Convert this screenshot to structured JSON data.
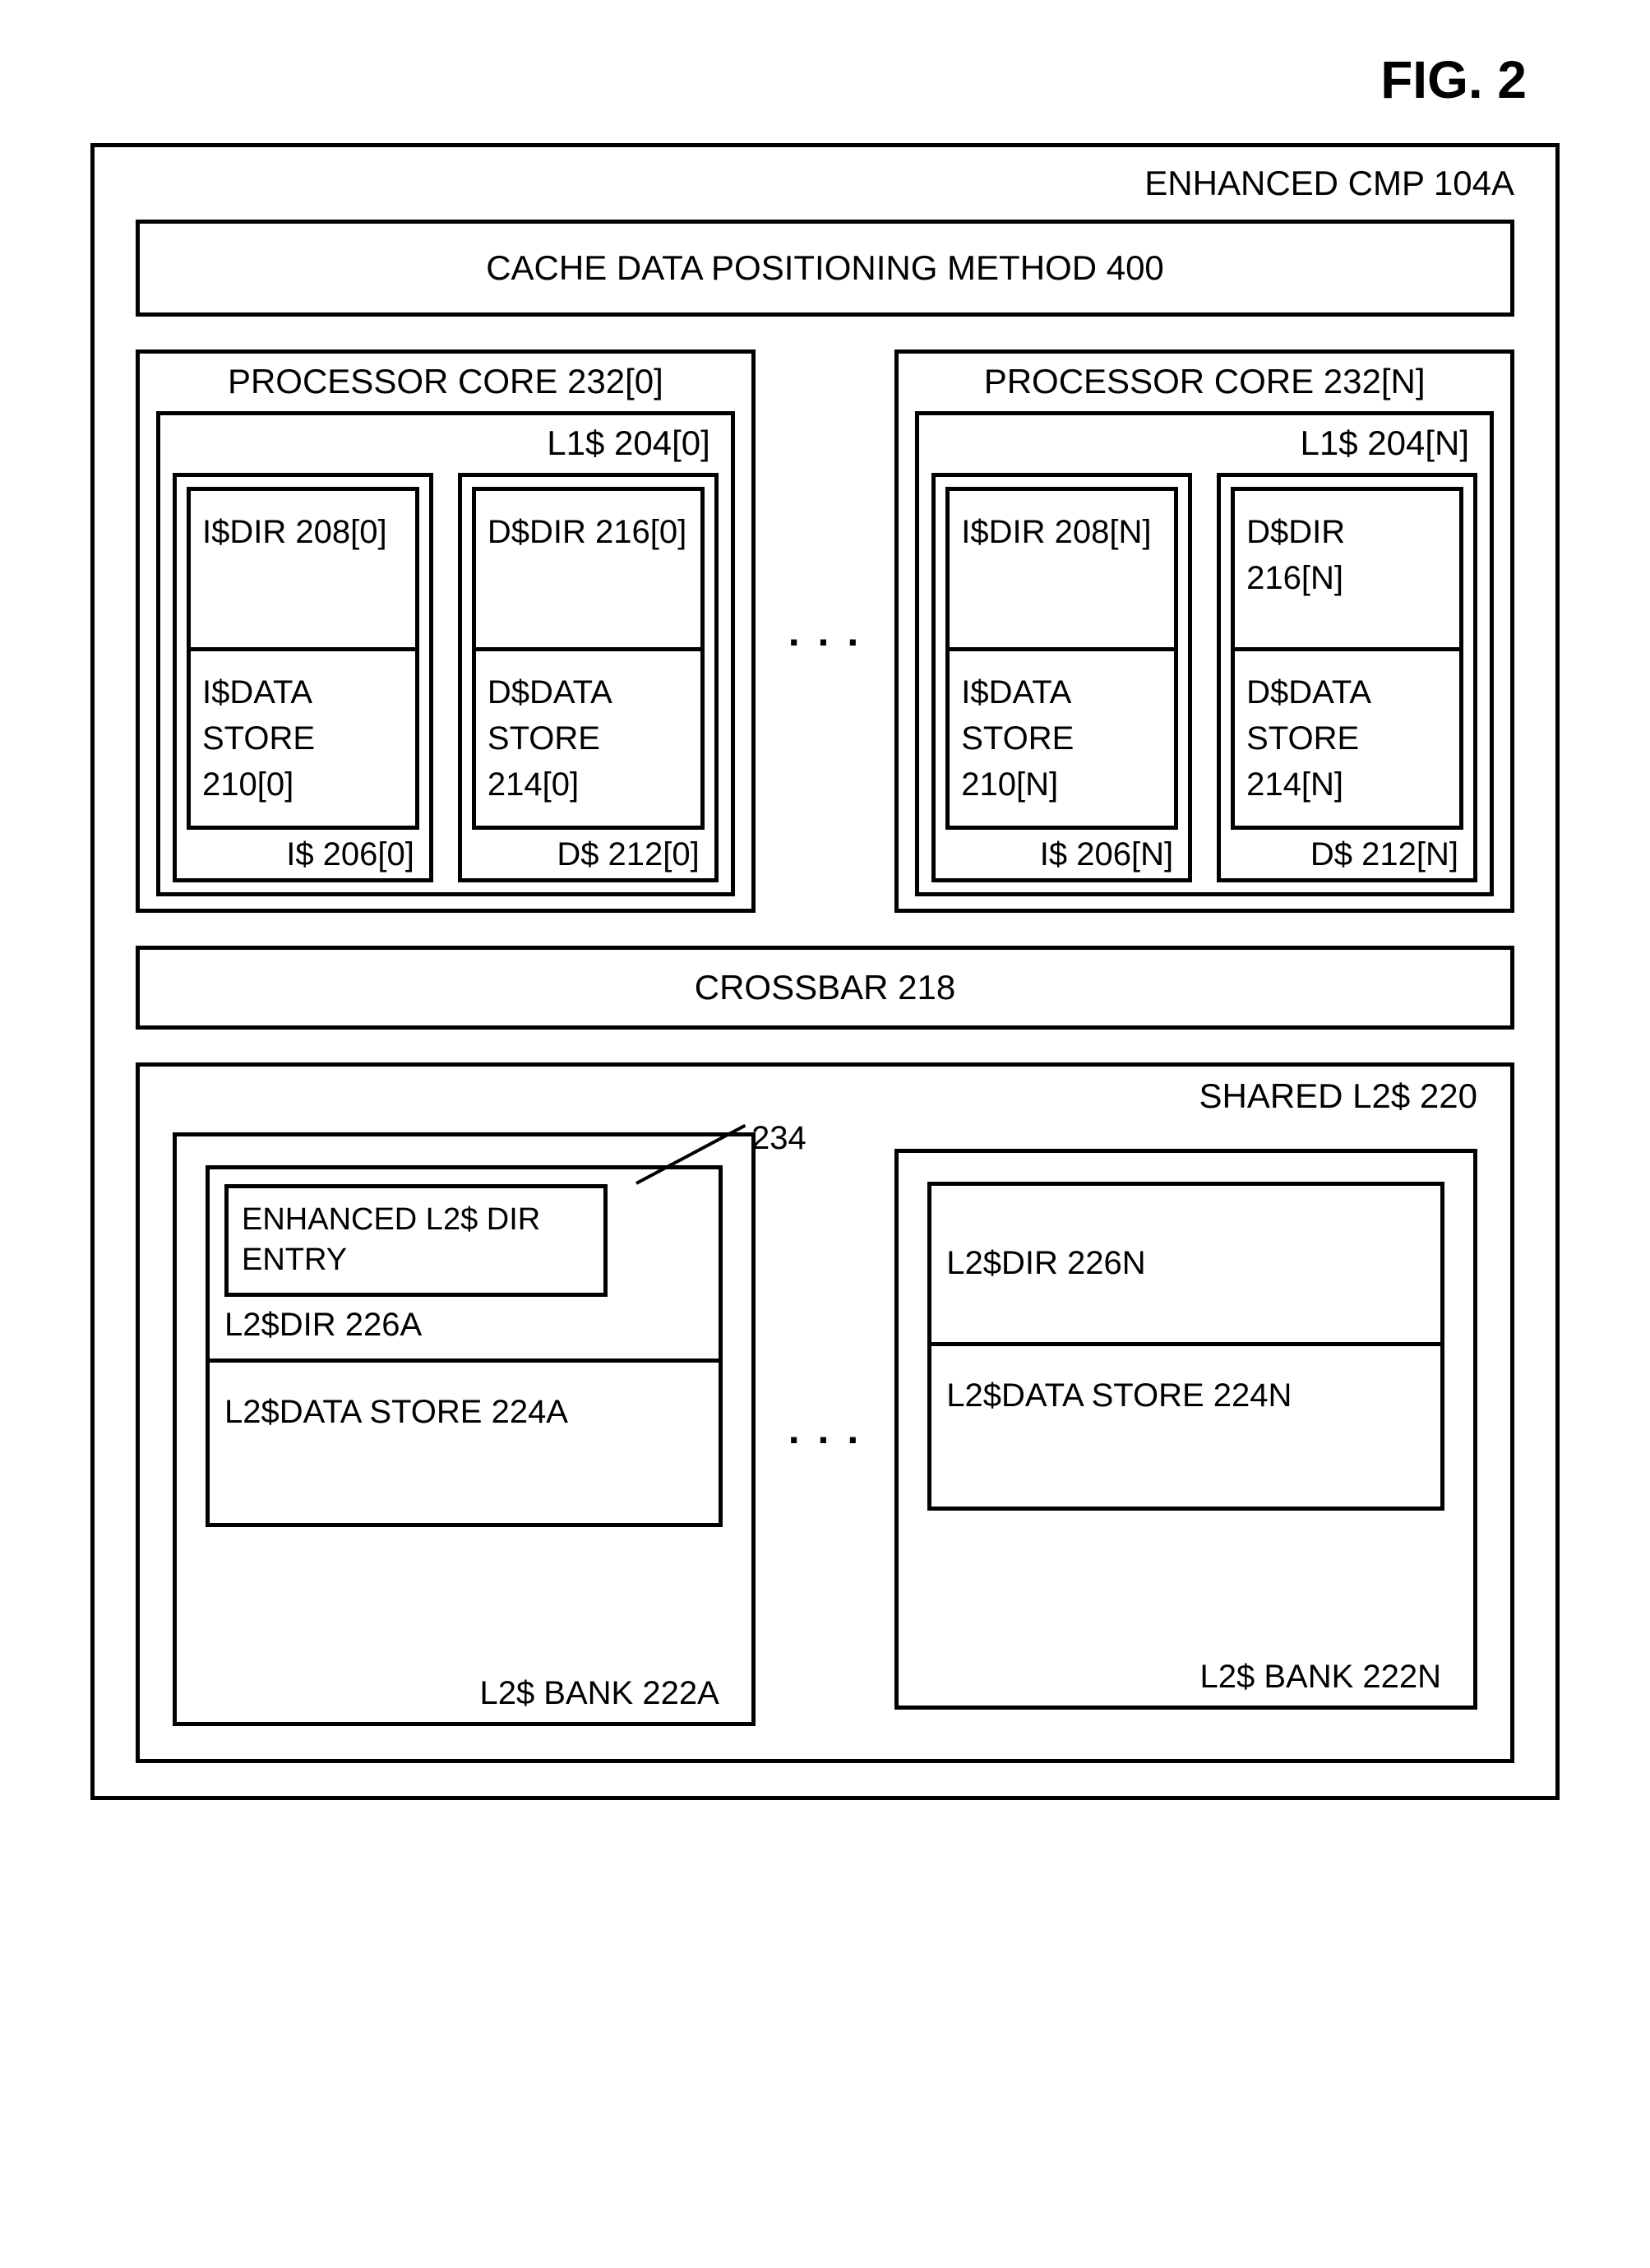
{
  "figure": {
    "title": "FIG. 2"
  },
  "outer": {
    "label": "ENHANCED CMP 104A"
  },
  "method": {
    "label": "CACHE DATA  POSITIONING METHOD 400"
  },
  "ellipsis": ". . .",
  "cores": [
    {
      "title": "PROCESSOR CORE 232[0]",
      "l1": {
        "label": "L1$ 204[0]",
        "icache": {
          "label": "I$ 206[0]",
          "dir": "I$DIR 208[0]",
          "store": "I$DATA STORE 210[0]"
        },
        "dcache": {
          "label": "D$ 212[0]",
          "dir": "D$DIR 216[0]",
          "store": "D$DATA STORE 214[0]"
        }
      }
    },
    {
      "title": "PROCESSOR CORE 232[N]",
      "l1": {
        "label": "L1$ 204[N]",
        "icache": {
          "label": "I$ 206[N]",
          "dir": "I$DIR 208[N]",
          "store": "I$DATA STORE 210[N]"
        },
        "dcache": {
          "label": "D$ 212[N]",
          "dir": "D$DIR 216[N]",
          "store": "D$DATA STORE 214[N]"
        }
      }
    }
  ],
  "crossbar": {
    "label": "CROSSBAR 218"
  },
  "shared": {
    "label": "SHARED L2$ 220",
    "banks": [
      {
        "label": "L2$ BANK 222A",
        "dir": "L2$DIR  226A",
        "store": "L2$DATA STORE 224A",
        "entry": {
          "label": "ENHANCED L2$ DIR ENTRY",
          "ref": "234"
        }
      },
      {
        "label": "L2$ BANK 222N",
        "dir": "L2$DIR  226N",
        "store": "L2$DATA STORE 224N"
      }
    ]
  }
}
